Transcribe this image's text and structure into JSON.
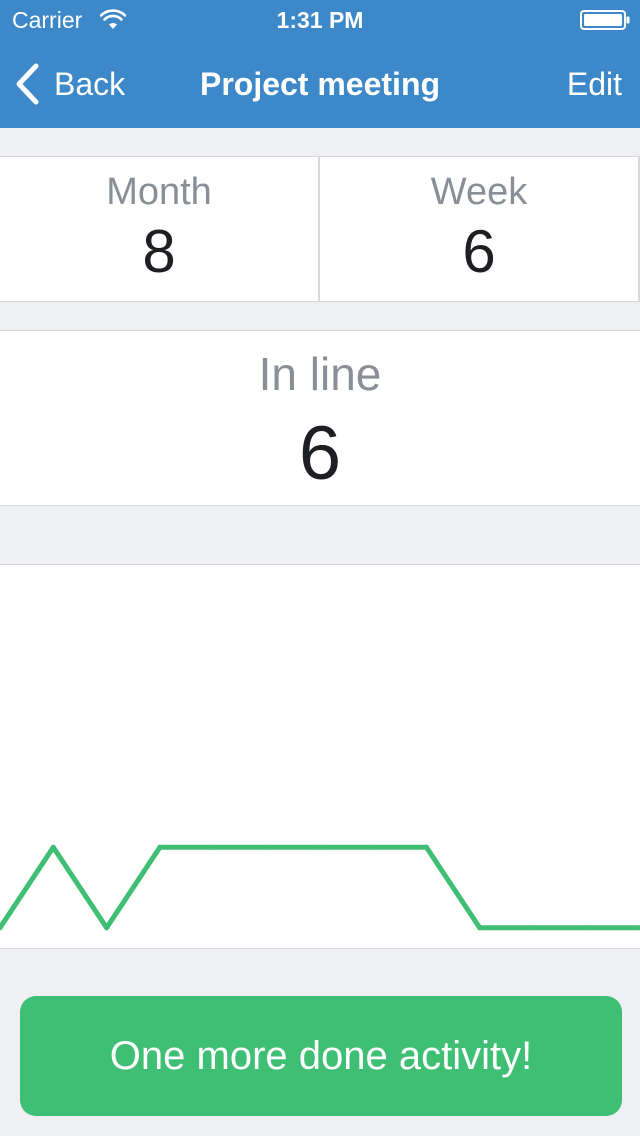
{
  "status_bar": {
    "carrier": "Carrier",
    "time": "1:31 PM",
    "wifi_icon": "wifi-icon",
    "battery_icon": "battery-icon"
  },
  "nav": {
    "back_label": "Back",
    "back_icon": "chevron-left-icon",
    "title": "Project meeting",
    "edit_label": "Edit"
  },
  "stats": {
    "month_label": "Month",
    "month_value": "8",
    "week_label": "Week",
    "week_value": "6",
    "inline_label": "In line",
    "inline_value": "6"
  },
  "chart_data": {
    "type": "line",
    "x": [
      0,
      1,
      2,
      3,
      4,
      5,
      6,
      7,
      8,
      9,
      10,
      11,
      12
    ],
    "values": [
      0,
      1,
      0,
      1,
      1,
      1,
      1,
      1,
      1,
      0,
      0,
      0,
      0
    ],
    "ylim": [
      -0.25,
      4.5
    ],
    "color": "#3ebf73",
    "grid": false
  },
  "action": {
    "label": "One more done activity!"
  },
  "colors": {
    "nav_background": "#3c88c8",
    "accent_green": "#3ebf73",
    "page_background": "#eff0f4"
  }
}
